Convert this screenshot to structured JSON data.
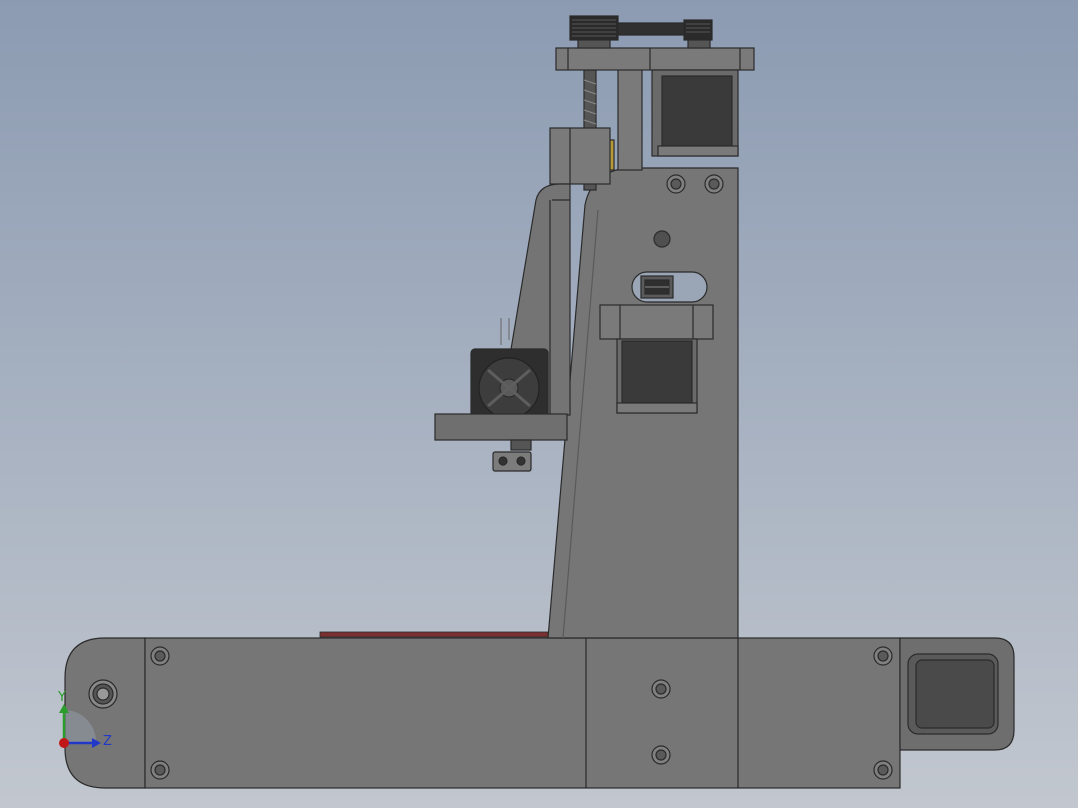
{
  "viewport": {
    "background_top": "#8c9bb2",
    "background_bottom": "#c2c7cf"
  },
  "model": {
    "body_color": "#747474",
    "edge_color": "#2b2b2b",
    "dark_color": "#333333",
    "motor_face_color": "#3a3a3a",
    "bed_strip_color": "#7a3030"
  },
  "triad": {
    "y_label": "Y",
    "z_label": "Z",
    "y_color": "#2a9d2a",
    "z_color": "#2238c8",
    "x_color": "#c01818"
  }
}
